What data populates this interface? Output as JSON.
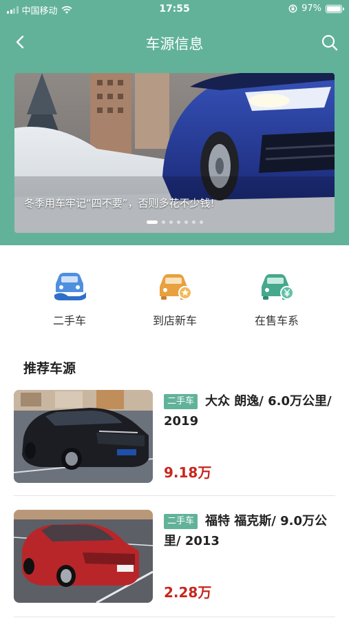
{
  "status_bar": {
    "carrier": "中国移动",
    "time": "17:55",
    "battery": "97%"
  },
  "nav": {
    "title": "车源信息"
  },
  "banner": {
    "caption": "冬季用车牢记“四不要”，否则多花不少钱!",
    "slide_count": 7,
    "active_slide": 1
  },
  "quick_links": [
    {
      "label": "二手车",
      "icon": "used-car-hand-icon",
      "color": "#4f8fe0"
    },
    {
      "label": "到店新车",
      "icon": "new-car-badge-icon",
      "color": "#e8a13e"
    },
    {
      "label": "在售车系",
      "icon": "car-yen-icon",
      "color": "#46a88d"
    }
  ],
  "section": {
    "title": "推荐车源"
  },
  "listings": [
    {
      "badge": "二手车",
      "title": "大众 朗逸/ 6.0万公里/ 2019",
      "price": "9.18万",
      "car_color": "#1b1d22"
    },
    {
      "badge": "二手车",
      "title": "福特 福克斯/ 9.0万公里/ 2013",
      "price": "2.28万",
      "car_color": "#b8262a"
    }
  ],
  "colors": {
    "primary": "#62b29a",
    "price": "#c8261d"
  }
}
